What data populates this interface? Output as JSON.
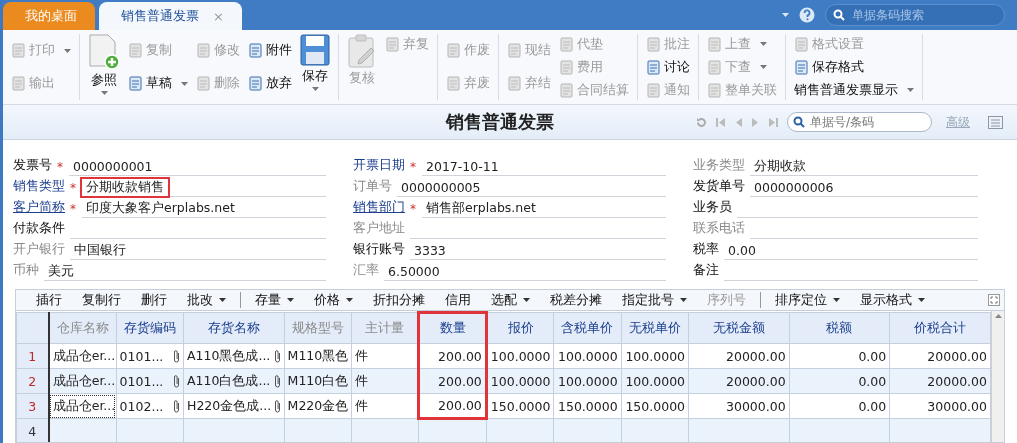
{
  "tabs": [
    {
      "label": "我的桌面",
      "selected": false
    },
    {
      "label": "销售普通发票",
      "selected": true,
      "close": "×"
    }
  ],
  "top_search": {
    "placeholder": "单据条码搜索"
  },
  "toolbar": {
    "groups": [
      {
        "columns": [
          [
            {
              "kind": "small",
              "label": "打印",
              "disabled": true,
              "dropdown": true
            },
            {
              "kind": "small",
              "label": "输出",
              "disabled": true,
              "dropdown": false
            }
          ]
        ]
      },
      {
        "columns": [
          [
            {
              "kind": "big",
              "label": "参照",
              "disabled": false,
              "dropdown": true
            }
          ],
          [
            {
              "kind": "small",
              "label": "复制",
              "disabled": true,
              "dropdown": false
            },
            {
              "kind": "small",
              "label": "草稿",
              "disabled": false,
              "dropdown": true
            }
          ],
          [
            {
              "kind": "small",
              "label": "修改",
              "disabled": true,
              "dropdown": false
            },
            {
              "kind": "small",
              "label": "删除",
              "disabled": true,
              "dropdown": false
            }
          ],
          [
            {
              "kind": "small",
              "label": "附件",
              "disabled": false,
              "dropdown": false
            },
            {
              "kind": "small",
              "label": "放弃",
              "disabled": false,
              "dropdown": false
            }
          ],
          [
            {
              "kind": "big",
              "label": "保存",
              "disabled": false,
              "dropdown": true
            }
          ]
        ]
      },
      {
        "columns": [
          [
            {
              "kind": "big",
              "label": "复核",
              "disabled": true,
              "dropdown": false
            }
          ],
          [
            {
              "kind": "small",
              "label": "弃复",
              "disabled": true,
              "dropdown": false
            }
          ]
        ]
      },
      {
        "columns": [
          [
            {
              "kind": "small",
              "label": "作废",
              "disabled": true,
              "dropdown": false
            },
            {
              "kind": "small",
              "label": "弃废",
              "disabled": true,
              "dropdown": false
            }
          ]
        ]
      },
      {
        "columns": [
          [
            {
              "kind": "small",
              "label": "现结",
              "disabled": true,
              "dropdown": false
            },
            {
              "kind": "small",
              "label": "弃结",
              "disabled": true,
              "dropdown": false
            }
          ],
          [
            {
              "kind": "small",
              "label": "代垫",
              "disabled": true,
              "dropdown": false
            },
            {
              "kind": "small",
              "label": "费用",
              "disabled": true,
              "dropdown": false
            },
            {
              "kind": "small",
              "label": "合同结算",
              "disabled": true,
              "dropdown": false
            }
          ]
        ]
      },
      {
        "columns": [
          [
            {
              "kind": "small",
              "label": "批注",
              "disabled": true,
              "dropdown": false
            },
            {
              "kind": "small",
              "label": "讨论",
              "disabled": false,
              "dropdown": false
            },
            {
              "kind": "small",
              "label": "通知",
              "disabled": true,
              "dropdown": false
            }
          ]
        ]
      },
      {
        "columns": [
          [
            {
              "kind": "small",
              "label": "上查",
              "disabled": true,
              "dropdown": true
            },
            {
              "kind": "small",
              "label": "下查",
              "disabled": true,
              "dropdown": true
            },
            {
              "kind": "small",
              "label": "整单关联",
              "disabled": true,
              "dropdown": false
            }
          ]
        ]
      },
      {
        "columns": [
          [
            {
              "kind": "small",
              "label": "格式设置",
              "disabled": true,
              "dropdown": false
            },
            {
              "kind": "small",
              "label": "保存格式",
              "disabled": false,
              "dropdown": false
            },
            {
              "kind": "text",
              "label": "销售普通发票显示",
              "disabled": false,
              "dropdown": true
            }
          ]
        ]
      }
    ]
  },
  "document": {
    "title": "销售普通发票",
    "search": {
      "placeholder": "单据号/条码"
    },
    "advanced": "高级"
  },
  "form": {
    "columns": [
      [
        {
          "label": "发票号",
          "kind": "plain",
          "mark": "*",
          "value": "0000000001",
          "highlighted": false
        },
        {
          "label": "销售类型",
          "kind": "key",
          "mark": "*",
          "value": "分期收款销售",
          "highlighted": true
        },
        {
          "label": "客户简称",
          "kind": "link",
          "mark": "*",
          "value": "印度大象客户erplabs.net",
          "highlighted": false
        },
        {
          "label": "付款条件",
          "kind": "plain",
          "highlighted": false
        },
        {
          "label": "开户银行",
          "kind": "muted",
          "value": "中国银行",
          "highlighted": false
        },
        {
          "label": "币种",
          "kind": "muted",
          "value": "美元",
          "highlighted": false
        }
      ],
      [
        {
          "label": "开票日期",
          "kind": "key",
          "mark": "*",
          "value": "2017-10-11",
          "highlighted": false
        },
        {
          "label": "订单号",
          "kind": "muted",
          "value": "0000000005",
          "highlighted": false
        },
        {
          "label": "销售部门",
          "kind": "link",
          "mark": "*",
          "value": "销售部erplabs.net",
          "highlighted": false
        },
        {
          "label": "客户地址",
          "kind": "muted",
          "highlighted": false
        },
        {
          "label": "银行账号",
          "kind": "plain",
          "value": "3333",
          "highlighted": false
        },
        {
          "label": "汇率",
          "kind": "muted",
          "value": "6.50000",
          "highlighted": false
        }
      ],
      [
        {
          "label": "业务类型",
          "kind": "muted",
          "value": "分期收款",
          "highlighted": false
        },
        {
          "label": "发货单号",
          "kind": "plain",
          "value": "0000000006",
          "highlighted": false
        },
        {
          "label": "业务员",
          "kind": "plain",
          "highlighted": false
        },
        {
          "label": "联系电话",
          "kind": "muted",
          "highlighted": false
        },
        {
          "label": "税率",
          "kind": "plain",
          "value": "0.00",
          "highlighted": false
        },
        {
          "label": "备注",
          "kind": "plain",
          "highlighted": false
        }
      ]
    ]
  },
  "grid_toolbar": [
    {
      "kind": "button",
      "label": "插行",
      "dropdown": false,
      "disabled": false
    },
    {
      "kind": "button",
      "label": "复制行",
      "dropdown": false,
      "disabled": false
    },
    {
      "kind": "button",
      "label": "删行",
      "dropdown": false,
      "disabled": false
    },
    {
      "kind": "button",
      "label": "批改",
      "dropdown": true,
      "disabled": false
    },
    {
      "kind": "separator"
    },
    {
      "kind": "button",
      "label": "存量",
      "dropdown": true,
      "disabled": false
    },
    {
      "kind": "button",
      "label": "价格",
      "dropdown": true,
      "disabled": false
    },
    {
      "kind": "button",
      "label": "折扣分摊",
      "dropdown": false,
      "disabled": false
    },
    {
      "kind": "button",
      "label": "信用",
      "dropdown": false,
      "disabled": false
    },
    {
      "kind": "button",
      "label": "选配",
      "dropdown": true,
      "disabled": false
    },
    {
      "kind": "button",
      "label": "税差分摊",
      "dropdown": false,
      "disabled": false
    },
    {
      "kind": "button",
      "label": "指定批号",
      "dropdown": true,
      "disabled": false
    },
    {
      "kind": "button",
      "label": "序列号",
      "dropdown": false,
      "disabled": true
    },
    {
      "kind": "separator"
    },
    {
      "kind": "button",
      "label": "排序定位",
      "dropdown": true,
      "disabled": false
    },
    {
      "kind": "button",
      "label": "显示格式",
      "dropdown": true,
      "disabled": false
    }
  ],
  "table": {
    "columns": [
      {
        "label": "仓库名称",
        "muted": true,
        "kind": "text",
        "attachment": false,
        "highlighted": false
      },
      {
        "label": "存货编码",
        "muted": false,
        "kind": "text",
        "attachment": true,
        "highlighted": false
      },
      {
        "label": "存货名称",
        "muted": false,
        "kind": "text",
        "attachment": true,
        "highlighted": false
      },
      {
        "label": "规格型号",
        "muted": true,
        "kind": "text",
        "attachment": false,
        "highlighted": false
      },
      {
        "label": "主计量",
        "muted": true,
        "kind": "text",
        "attachment": false,
        "highlighted": false
      },
      {
        "label": "数量",
        "muted": false,
        "kind": "number",
        "attachment": false,
        "highlighted": true
      },
      {
        "label": "报价",
        "muted": false,
        "kind": "number",
        "attachment": false,
        "highlighted": false
      },
      {
        "label": "含税单价",
        "muted": false,
        "kind": "number",
        "attachment": false,
        "highlighted": false
      },
      {
        "label": "无税单价",
        "muted": false,
        "kind": "number",
        "attachment": false,
        "highlighted": false
      },
      {
        "label": "无税金额",
        "muted": false,
        "kind": "number",
        "attachment": false,
        "highlighted": false
      },
      {
        "label": "税额",
        "muted": false,
        "kind": "number",
        "attachment": false,
        "highlighted": false
      },
      {
        "label": "价税合计",
        "muted": false,
        "kind": "number",
        "attachment": false,
        "highlighted": false
      }
    ],
    "rows": [
      {
        "number": "1",
        "marked": true,
        "focused": false,
        "cells": [
          "成品仓er...",
          "0101...",
          "A110黑色成...",
          "M110黑色",
          "件",
          "200.00",
          "100.0000",
          "100.0000",
          "100.0000",
          "20000.00",
          "0.00",
          "20000.00"
        ]
      },
      {
        "number": "2",
        "marked": true,
        "focused": false,
        "cells": [
          "成品仓er...",
          "0101...",
          "A110白色成...",
          "M110白色",
          "件",
          "200.00",
          "100.0000",
          "100.0000",
          "100.0000",
          "20000.00",
          "0.00",
          "20000.00"
        ]
      },
      {
        "number": "3",
        "marked": true,
        "focused": true,
        "cells": [
          "成品仓er...",
          "0102...",
          "H220金色成...",
          "M220金色",
          "件",
          "200.00",
          "150.0000",
          "150.0000",
          "150.0000",
          "30000.00",
          "0.00",
          "30000.00"
        ]
      },
      {
        "number": "4",
        "marked": false,
        "focused": false,
        "cells": []
      }
    ]
  }
}
